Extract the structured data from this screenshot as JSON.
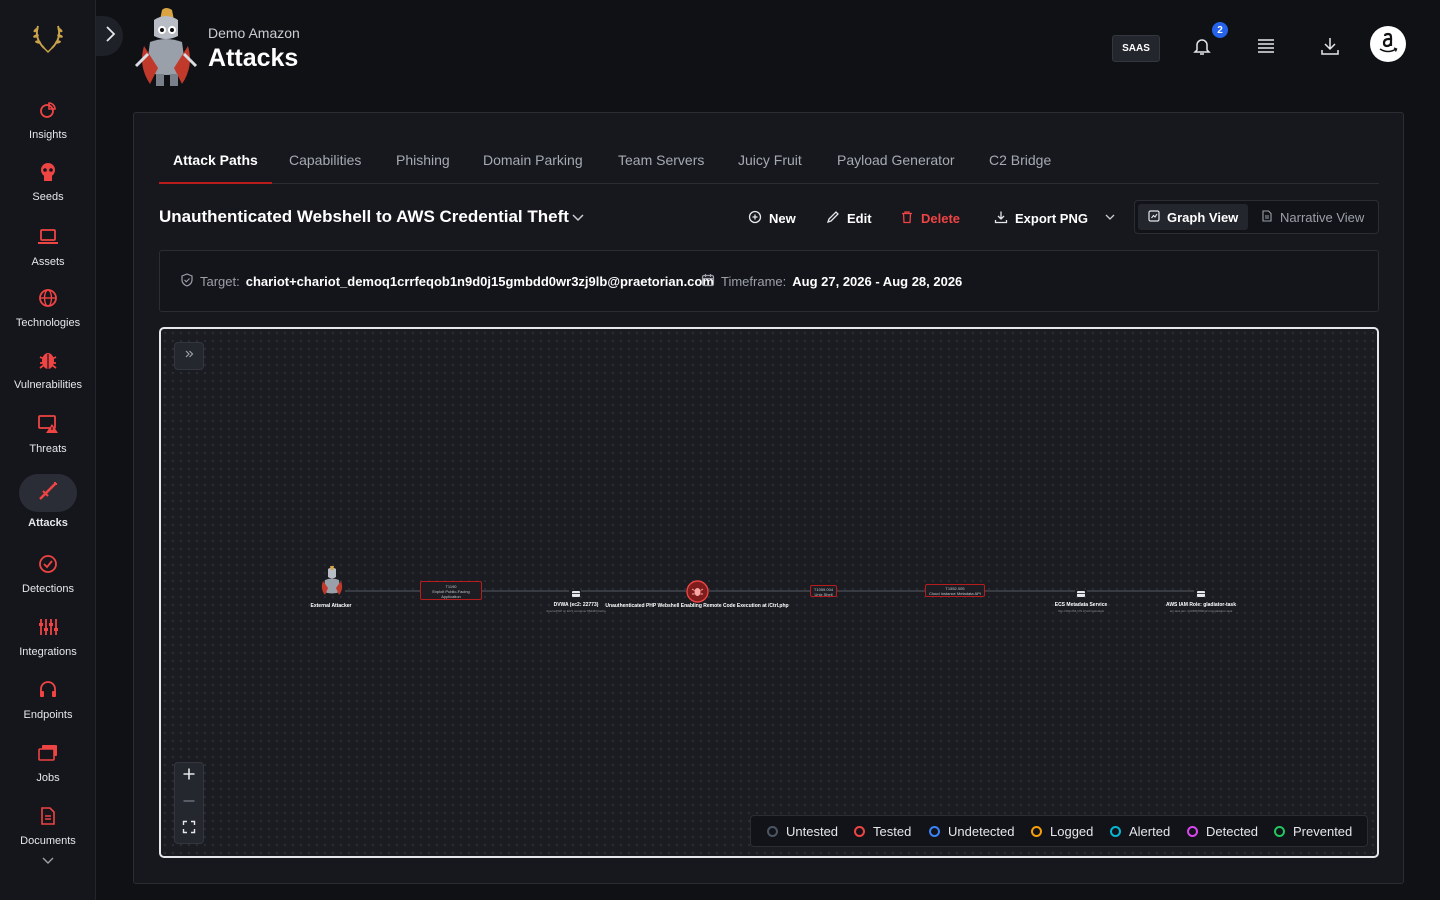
{
  "org_name": "Demo Amazon",
  "page_title": "Attacks",
  "saas_label": "SAAS",
  "notification_count": "2",
  "sidebar": {
    "items": [
      {
        "label": "Insights",
        "icon": "insights-icon"
      },
      {
        "label": "Seeds",
        "icon": "seeds-icon"
      },
      {
        "label": "Assets",
        "icon": "laptop-icon"
      },
      {
        "label": "Technologies",
        "icon": "globe-icon"
      },
      {
        "label": "Vulnerabilities",
        "icon": "bug-icon"
      },
      {
        "label": "Threats",
        "icon": "threat-icon"
      },
      {
        "label": "Attacks",
        "icon": "sword-icon",
        "active": true
      },
      {
        "label": "Detections",
        "icon": "check-circle-icon"
      },
      {
        "label": "Integrations",
        "icon": "integrations-icon"
      },
      {
        "label": "Endpoints",
        "icon": "headset-icon"
      },
      {
        "label": "Jobs",
        "icon": "jobs-icon"
      },
      {
        "label": "Documents",
        "icon": "document-icon"
      }
    ]
  },
  "tabs": [
    {
      "label": "Attack Paths",
      "active": true
    },
    {
      "label": "Capabilities"
    },
    {
      "label": "Phishing"
    },
    {
      "label": "Domain Parking"
    },
    {
      "label": "Team Servers"
    },
    {
      "label": "Juicy Fruit"
    },
    {
      "label": "Payload Generator"
    },
    {
      "label": "C2 Bridge"
    }
  ],
  "attack_path": {
    "title": "Unauthenticated Webshell to AWS Credential Theft",
    "actions": {
      "new": "New",
      "edit": "Edit",
      "delete": "Delete",
      "export": "Export PNG"
    },
    "views": {
      "graph": "Graph View",
      "narrative": "Narrative View"
    },
    "target_label": "Target:",
    "target_value": "chariot+chariot_demoq1crrfeqob1n9d0j15gmbdd0wr3zj9lb@praetorian.com",
    "timeframe_label": "Timeframe:",
    "timeframe_value": "Aug 27, 2026 - Aug 28, 2026"
  },
  "graph_nodes": [
    {
      "caption": "External Attacker",
      "sub": ""
    },
    {
      "box_lines": [
        "T1190",
        "Exploit Public-Facing",
        "Application"
      ]
    },
    {
      "caption": "DVWA (ec2: 22773)",
      "sub": "dpwmsPHP on ECS container 85dd8 Dvwba"
    },
    {
      "caption": "Unauthenticated PHP Webshell Enabling Remote Code Execution at /Ctrl.php",
      "sub": ""
    },
    {
      "box_lines": [
        "T1059.004",
        "Unix Shell"
      ]
    },
    {
      "box_lines": [
        "T1552.005",
        "Cloud Instance Metadata API"
      ]
    },
    {
      "caption": "ECS Metadata Service",
      "sub": "http://169.254.170.2/v2/credentials"
    },
    {
      "caption": "AWS IAM Role: gladiator-task",
      "sub": "arn:aws:iam::123456789012:role/gladiator-task"
    }
  ],
  "legend": [
    {
      "label": "Untested",
      "color": "#4b5563"
    },
    {
      "label": "Tested",
      "color": "#ef4444"
    },
    {
      "label": "Undetected",
      "color": "#3b82f6"
    },
    {
      "label": "Logged",
      "color": "#f59e0b"
    },
    {
      "label": "Alerted",
      "color": "#06b6d4"
    },
    {
      "label": "Detected",
      "color": "#d946ef"
    },
    {
      "label": "Prevented",
      "color": "#22c55e"
    }
  ],
  "colors": {
    "accent_red": "#b91c1c",
    "danger_red": "#ef4444",
    "notification_blue": "#2563eb"
  }
}
